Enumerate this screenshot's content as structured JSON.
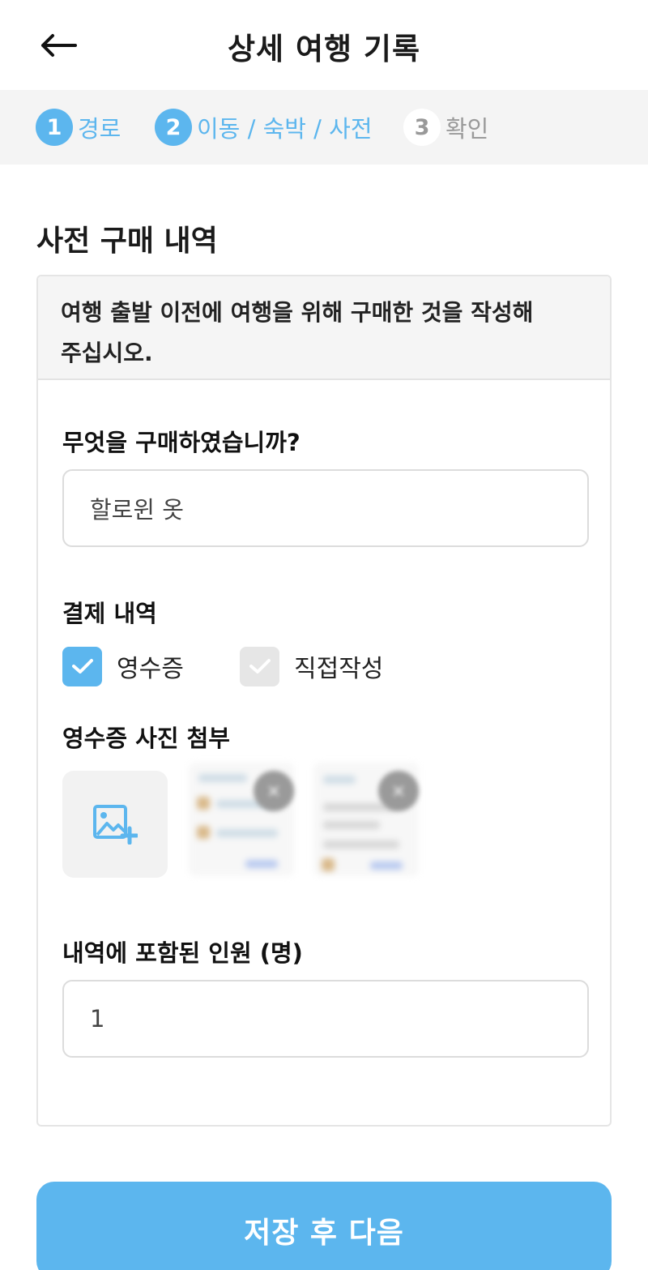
{
  "header": {
    "title": "상세 여행 기록",
    "back_icon": "arrow-left-icon"
  },
  "stepper": {
    "steps": [
      {
        "number": "1",
        "label": "경로",
        "state": "active"
      },
      {
        "number": "2",
        "label": "이동 / 숙박 / 사전",
        "state": "active"
      },
      {
        "number": "3",
        "label": "확인",
        "state": "inactive"
      }
    ]
  },
  "section": {
    "title": "사전 구매 내역"
  },
  "card": {
    "notice_line1": "여행 출발 이전에 여행을 위해 구매한 것을 작성해",
    "notice_line2": "주십시오.",
    "purchase": {
      "label": "무엇을 구매하였습니까?",
      "value": "할로윈 옷"
    },
    "payment": {
      "label": "결제 내역",
      "options": [
        {
          "label": "영수증",
          "checked": true
        },
        {
          "label": "직접작성",
          "checked": false
        }
      ]
    },
    "receipt": {
      "label": "영수증 사진 첨부",
      "add_icon": "add-photo-icon",
      "remove_icon": "close-icon"
    },
    "people": {
      "label": "내역에 포함된 인원 (명)",
      "value": "1"
    }
  },
  "footer": {
    "save_label": "저장 후 다음"
  },
  "colors": {
    "accent": "#5cb6ee",
    "stepper_bg": "#f4f4f4",
    "notice_bg": "#f5f5f5"
  }
}
